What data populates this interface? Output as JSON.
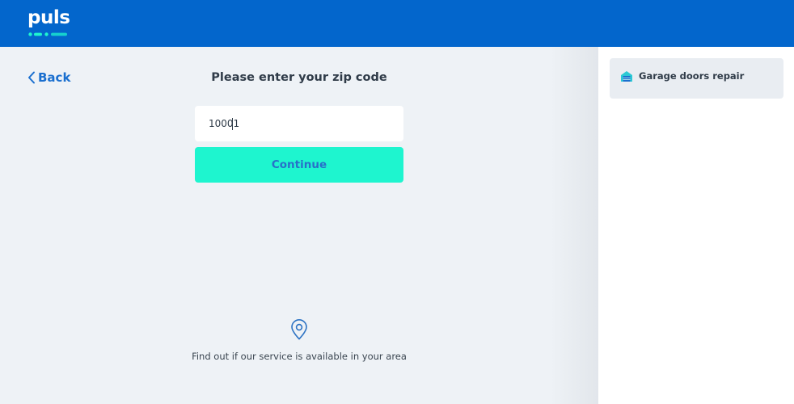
{
  "header": {
    "logo_text": "puls",
    "background": "#0366cc"
  },
  "nav": {
    "back_label": "Back"
  },
  "form": {
    "title": "Please enter your zip code",
    "zip_value": "10001",
    "continue_label": "Continue",
    "accent": "#1ef5cf"
  },
  "footer_info": {
    "icon": "location-pin-icon",
    "text": "Find out if our service is available in your area"
  },
  "sidebar": {
    "service": {
      "icon": "garage-icon",
      "label": "Garage doors repair"
    }
  }
}
